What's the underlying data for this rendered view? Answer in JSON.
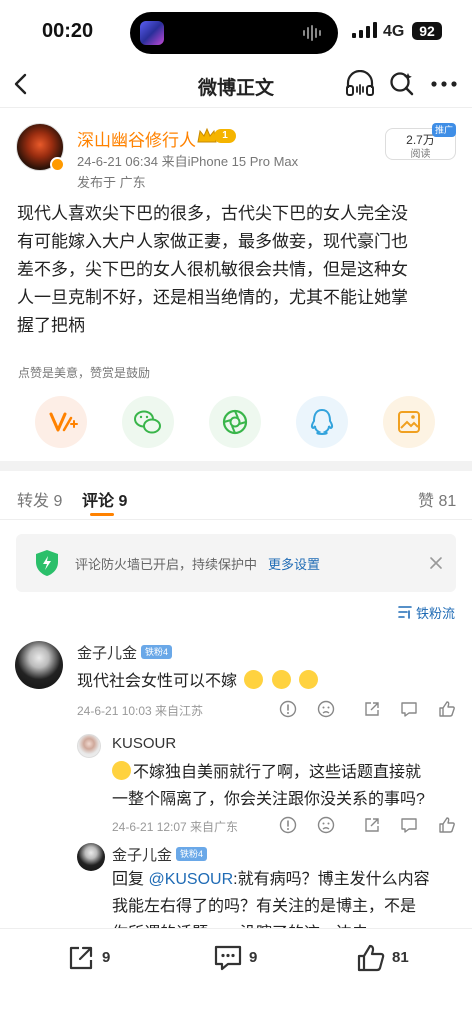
{
  "status_bar": {
    "time": "00:20",
    "network": "4G",
    "battery": "92"
  },
  "nav": {
    "title": "微博正文"
  },
  "post": {
    "author": "深山幽谷修行人",
    "level_badge": "1",
    "meta": "24-6-21 06:34  来自iPhone 15 Pro Max",
    "location": "发布于 广东",
    "reads_count": "2.7万",
    "reads_label": "阅读",
    "promo_tag": "推广",
    "body_lines": [
      "现代人喜欢尖下巴的很多，古代尖下巴的女人完全没",
      "有可能嫁入大户人家做正妻，最多做妾，现代豪门也",
      "差不多，尖下巴的女人很机敏很会共情，但是这种女",
      "人一旦克制不好，还是相当绝情的，尤其不能让她掌",
      "握了把柄"
    ],
    "reward_hint": "点赞是美意，赞赏是鼓励"
  },
  "tabs": {
    "repost": "转发 9",
    "comments": "评论 9",
    "likes": "赞 81"
  },
  "firewall": {
    "text": "评论防火墙已开启，持续保护中",
    "link": "更多设置"
  },
  "sort_label": "铁粉流",
  "comments": [
    {
      "name": "金子儿金",
      "badge": "铁粉4",
      "text": "现代社会女性可以不嫁",
      "meta": "24-6-21 10:03  来自江苏"
    },
    {
      "name": "KUSOUR",
      "text_line1": "不嫁独自美丽就行了啊，这些话题直接就",
      "text_line2": "一整个隔离了，你会关注跟你没关系的事吗?",
      "meta": "24-6-21 12:07  来自广东"
    },
    {
      "name": "金子儿金",
      "badge": "铁粉4",
      "reply_prefix": "回复 ",
      "mention": "@KUSOUR",
      "text_line1": ":就有病吗？博主发什么内容",
      "text_line2": "我能左右得了的吗？有关注的是博主，不是",
      "text_line3": "你所谓的话题……没瞎了的这一边去"
    }
  ],
  "bottom_bar": {
    "repost_count": "9",
    "comment_count": "9",
    "like_count": "81"
  },
  "colors": {
    "orange": "#ff8200",
    "link_blue": "#1f6bb5",
    "fire_green": "#2bbf6a"
  }
}
